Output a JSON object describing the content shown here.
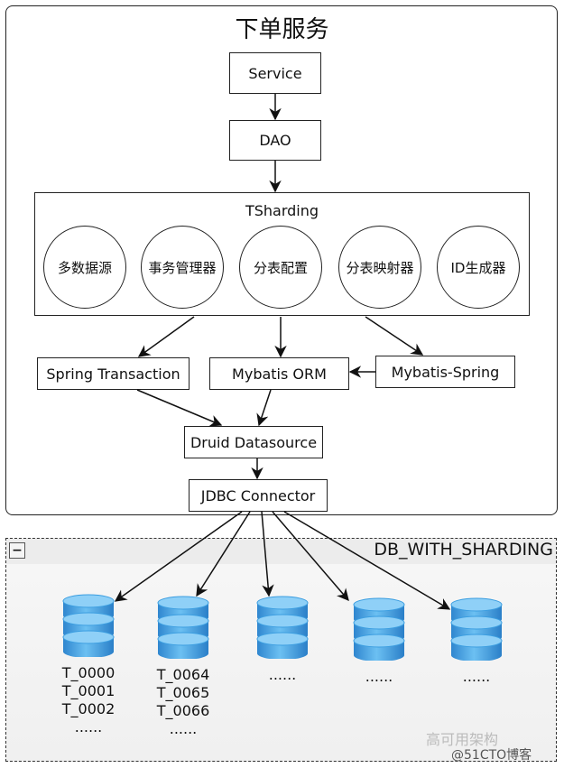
{
  "service_container": {
    "title": "下单服务"
  },
  "nodes": {
    "service": "Service",
    "dao": "DAO",
    "tsharding": {
      "title": "TSharding",
      "components": [
        "多数据源",
        "事务管理器",
        "分表配置",
        "分表映射器",
        "ID生成器"
      ]
    },
    "spring_transaction": "Spring Transaction",
    "mybatis_orm": "Mybatis ORM",
    "mybatis_spring": "Mybatis-Spring",
    "druid_datasource": "Druid Datasource",
    "jdbc_connector": "JDBC Connector"
  },
  "db_group": {
    "title": "DB_WITH_SHARDING",
    "collapse_symbol": "−",
    "databases": [
      {
        "tables": [
          "T_0000",
          "T_0001",
          "T_0002",
          "......"
        ]
      },
      {
        "tables": [
          "T_0064",
          "T_0065",
          "T_0066",
          "......"
        ]
      },
      {
        "tables": [
          "......"
        ]
      },
      {
        "tables": [
          "......"
        ]
      },
      {
        "tables": [
          "......"
        ]
      }
    ]
  },
  "watermark": {
    "primary": "高可用架构",
    "secondary": "@51CTO博客"
  },
  "colors": {
    "db_blue": "#3a9de0",
    "db_light": "#8fd0f7",
    "line": "#111111"
  }
}
